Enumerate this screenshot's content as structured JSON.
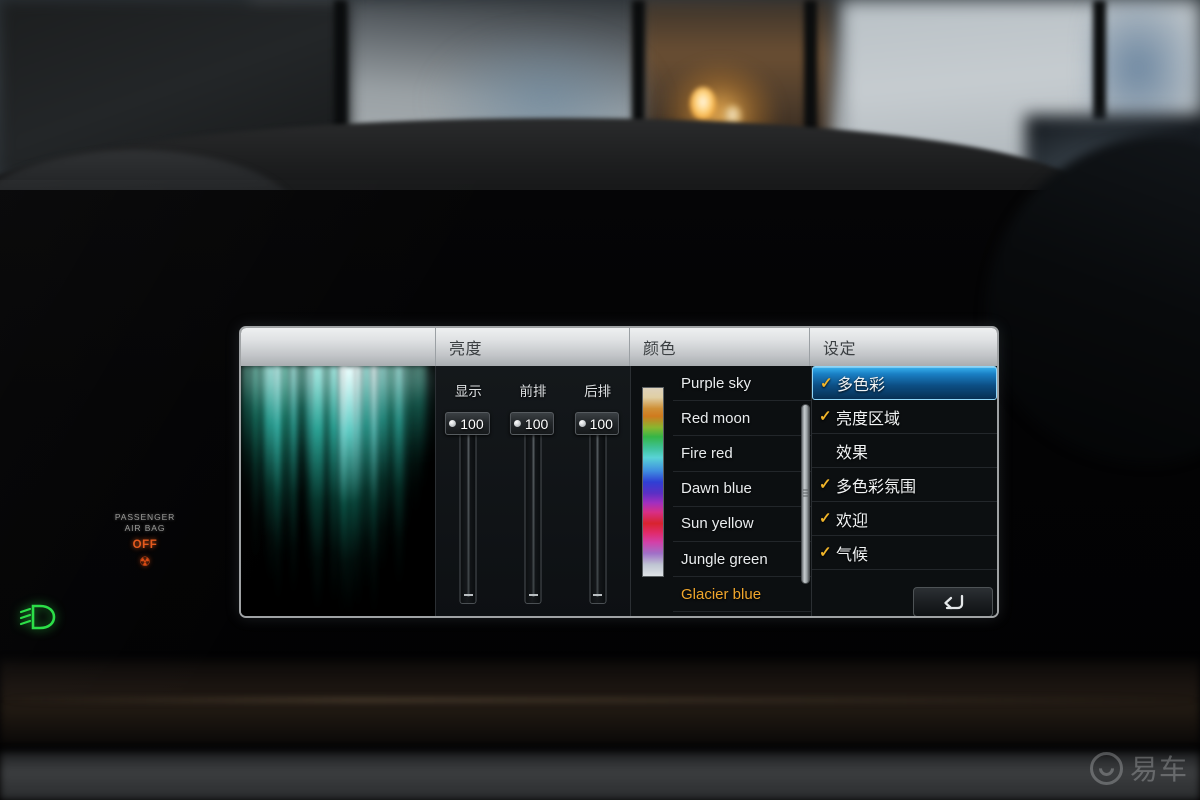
{
  "vehicle_cluster": {
    "airbag_line1": "PASSENGER",
    "airbag_line2": "AIR BAG",
    "airbag_status": "OFF",
    "airbag_icon": "airbag-warning-icon",
    "headlight_icon": "low-beam-headlight-icon",
    "headlight_color": "#2ade46",
    "airbag_off_color": "#e4591c"
  },
  "panel": {
    "headers": {
      "preview": "",
      "brightness": "亮度",
      "color": "颜色",
      "settings": "设定"
    },
    "brightness": {
      "sliders": [
        {
          "label": "显示",
          "value": "100",
          "icon": "slider-knob-icon"
        },
        {
          "label": "前排",
          "value": "100",
          "icon": "slider-knob-icon"
        },
        {
          "label": "后排",
          "value": "100",
          "icon": "slider-knob-icon"
        }
      ]
    },
    "color": {
      "gradient_icon": "color-gradient-strip",
      "items": [
        {
          "label": "Purple sky",
          "selected": false
        },
        {
          "label": "Red moon",
          "selected": false
        },
        {
          "label": "Fire red",
          "selected": false
        },
        {
          "label": "Dawn blue",
          "selected": false
        },
        {
          "label": "Sun yellow",
          "selected": false
        },
        {
          "label": "Jungle green",
          "selected": false
        },
        {
          "label": "Glacier blue",
          "selected": true
        }
      ],
      "selected_color_hex": "#f0a62c",
      "scrollbar_icon": "vertical-scrollbar"
    },
    "settings": {
      "items": [
        {
          "label": "多色彩",
          "checked": true,
          "active": true
        },
        {
          "label": "亮度区域",
          "checked": true,
          "active": false
        },
        {
          "label": "效果",
          "checked": false,
          "active": false
        },
        {
          "label": "多色彩氛围",
          "checked": true,
          "active": false
        },
        {
          "label": "欢迎",
          "checked": true,
          "active": false
        },
        {
          "label": "气候",
          "checked": true,
          "active": false
        }
      ],
      "check_glyph": "✓",
      "check_color": "#f0b429",
      "active_color": "#1a7fc4",
      "back_button_icon": "back-arrow-icon"
    },
    "preview": {
      "icon": "aurora-preview-image",
      "description": "Aurora"
    }
  },
  "watermark": {
    "text": "易车",
    "icon": "yiche-logo-icon"
  }
}
